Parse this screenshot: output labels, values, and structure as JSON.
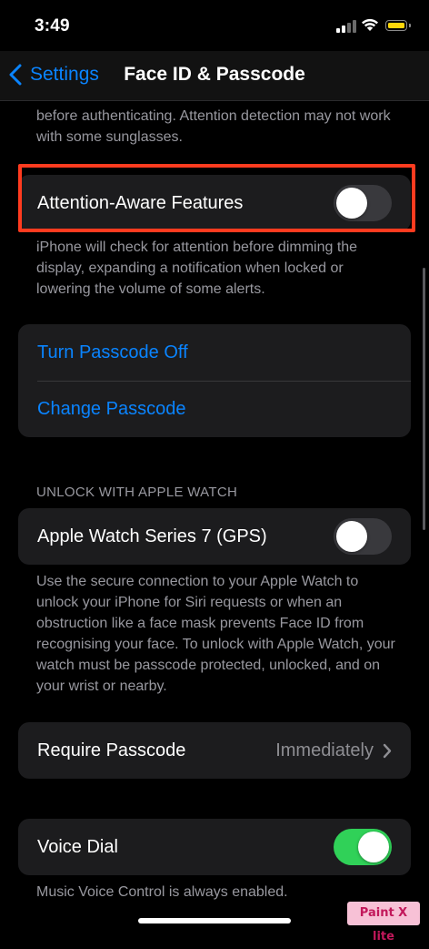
{
  "status_bar": {
    "time": "3:49",
    "battery_color": "#ffd60a"
  },
  "nav": {
    "back_label": "Settings",
    "title": "Face ID & Passcode"
  },
  "top_footnote": "before authenticating. Attention detection may not work with some sunglasses.",
  "attention": {
    "label": "Attention-Aware Features",
    "enabled": false,
    "footnote": "iPhone will check for attention before dimming the display, expanding a notification when locked or lowering the volume of some alerts.",
    "highlight_color": "#ff3b1f"
  },
  "passcode_group": {
    "turn_off": "Turn Passcode Off",
    "change": "Change Passcode"
  },
  "apple_watch": {
    "header": "UNLOCK WITH APPLE WATCH",
    "label": "Apple Watch Series 7 (GPS)",
    "enabled": false,
    "footnote": "Use the secure connection to your Apple Watch to unlock your iPhone for Siri requests or when an obstruction like a face mask prevents Face ID from recognising your face. To unlock with Apple Watch, your watch must be passcode protected, unlocked, and on your wrist or nearby."
  },
  "require_passcode": {
    "label": "Require Passcode",
    "value": "Immediately"
  },
  "voice_dial": {
    "label": "Voice Dial",
    "enabled": true,
    "footnote": "Music Voice Control is always enabled."
  },
  "watermark": "Paint X lite",
  "colors": {
    "accent": "#0a84ff",
    "toggle_on": "#30d158"
  }
}
